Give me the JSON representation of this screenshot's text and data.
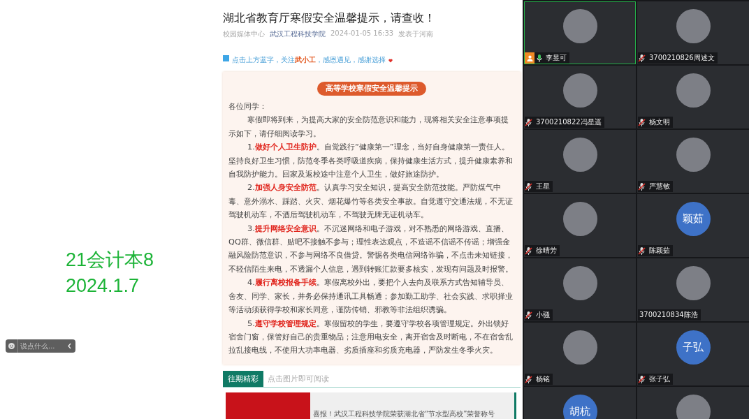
{
  "left_panel": {
    "caption_lines": [
      "21会计本8",
      "2024.1.7"
    ],
    "chat_input": {
      "placeholder": "说点什么..."
    }
  },
  "article": {
    "title": "湖北省教育厅寒假安全温馨提示，请查收！",
    "meta": {
      "source": "校园媒体中心",
      "account": "武汉工程科技学院",
      "date": "2024-01-05 16:33",
      "location": "发表于河南"
    },
    "follow_hint": "点击上方蓝字，关注**武小工**，感恩遇见，感谢选择",
    "card": {
      "heading": "高等学校寒假安全温馨提示",
      "greeting": "各位同学：",
      "paragraphs": [
        "寒假即将到来，为提高大家的安全防范意识和能力，现将相关安全注意事项提示如下，请仔细阅读学习。",
        "1.**做好个人卫生防护**。自觉践行“健康第一”理念，当好自身健康第一责任人。坚持良好卫生习惯，防范冬季各类呼吸道疾病，保持健康生活方式，提升健康素养和自我防护能力。回家及返校途中注意个人卫生，做好旅途防护。",
        "2.**加强人身安全防范**。认真学习安全知识，提高安全防范技能。严防煤气中毒、意外溺水、踩踏、火灾、烟花爆竹等各类安全事故。自觉遵守交通法规，不无证驾驶机动车，不酒后驾驶机动车，不驾驶无牌无证机动车。",
        "3.**提升网络安全意识**。不沉迷网络和电子游戏，对不熟悉的网络游戏、直播、QQ群、微信群、贴吧不接触不参与；理性表达观点，不造谣不信谣不传谣；增强金融风险防范意识，不参与网络不良借贷。警惕各类电信网络诈骗，不点击未知链接，不轻信陌生来电，不透漏个人信息，遇到转账汇款要多核实，发现有问题及时报警。",
        "4.**履行离校报备手续**。寒假离校外出，要把个人去向及联系方式告知辅导员、舍友、同学、家长，并务必保持通讯工具畅通；参加勤工助学、社会实践、求职择业等活动须获得学校和家长同意，谨防传销、邪教等非法组织诱骗。",
        "5.**遵守学校管理规定**。寒假留校的学生，要遵守学校各项管理规定。外出锁好宿舍门窗，保管好自己的贵重物品；注意用电安全，离开宿舍及时断电，不在宿舍乱拉乱接电线，不使用大功率电器、劣质插座和劣质充电器，严防发生冬季火灾。"
      ]
    },
    "related": {
      "tab": {
        "label": "往期精彩",
        "selected": true
      },
      "hint": "点击图片即可阅读",
      "items": [
        {
          "title": "喜报！武汉工程科技学院荣获湖北省“节水型高校”荣誉称号"
        }
      ]
    }
  },
  "participants": [
    {
      "kind": "photo",
      "name": "李昱可",
      "muted": false,
      "host": true,
      "selected": true
    },
    {
      "kind": "photo",
      "name": "3700210826周述文",
      "muted": true,
      "host": false,
      "selected": false
    },
    {
      "kind": "photo",
      "name": "3700210822冯星遥",
      "muted": true,
      "host": false,
      "selected": false
    },
    {
      "kind": "photo",
      "name": "杨文明",
      "muted": true,
      "host": false,
      "selected": false
    },
    {
      "kind": "photo",
      "name": "王星",
      "muted": true,
      "host": false,
      "selected": false
    },
    {
      "kind": "photo",
      "name": "严慧敏",
      "muted": true,
      "host": false,
      "selected": false
    },
    {
      "kind": "photo",
      "name": "徐晴芳",
      "muted": true,
      "host": false,
      "selected": false
    },
    {
      "kind": "initials",
      "name": "陈颖茹",
      "muted": true,
      "host": false,
      "selected": false,
      "avatar_text": "颖茹"
    },
    {
      "kind": "photo",
      "name": "小骚",
      "muted": true,
      "host": false,
      "selected": false
    },
    {
      "kind": "photo",
      "name": "3700210834陈浩",
      "host": false,
      "selected": false
    },
    {
      "kind": "photo",
      "name": "杨铭",
      "muted": true,
      "host": false,
      "selected": false
    },
    {
      "kind": "initials",
      "name": "张子弘",
      "muted": true,
      "host": false,
      "selected": false,
      "avatar_text": "子弘"
    },
    {
      "kind": "initials",
      "selected": false,
      "avatar_text": "胡杭"
    },
    {
      "kind": "photo",
      "selected": false
    }
  ]
}
